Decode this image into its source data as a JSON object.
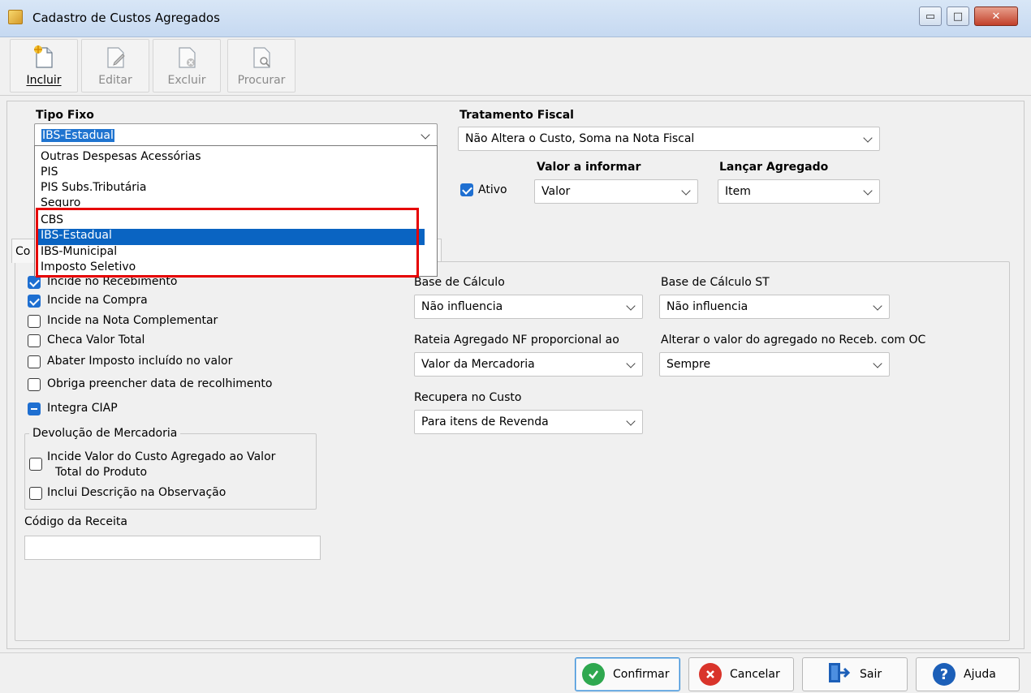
{
  "window": {
    "title": "Cadastro de Custos Agregados",
    "minimize_glyph": "▭",
    "maximize_glyph": "□",
    "close_glyph": "✕"
  },
  "toolbar": {
    "buttons": [
      {
        "label": "Incluir",
        "icon": "new-document-icon",
        "enabled": true
      },
      {
        "label": "Editar",
        "icon": "edit-document-icon",
        "enabled": false
      },
      {
        "label": "Excluir",
        "icon": "delete-document-icon",
        "enabled": false
      },
      {
        "label": "Procurar",
        "icon": "search-document-icon",
        "enabled": false
      }
    ]
  },
  "form": {
    "tipo_fixo": {
      "label": "Tipo Fixo",
      "value": "IBS-Estadual"
    },
    "tratamento_fiscal": {
      "label": "Tratamento Fiscal",
      "value": "Não Altera o Custo, Soma na Nota Fiscal"
    },
    "ativo": {
      "label": "Ativo",
      "checked": true
    },
    "valor_a_informar": {
      "label": "Valor a informar",
      "value": "Valor"
    },
    "lancar_agregado": {
      "label": "Lançar Agregado",
      "value": "Item"
    },
    "tab_stub": "Co",
    "dropdown_options": [
      "Outras Despesas Acessórias",
      "PIS",
      "PIS Subs.Tributária",
      "Seguro",
      "CBS",
      "IBS-Estadual",
      "IBS-Municipal",
      "Imposto Seletivo"
    ],
    "dropdown_selected": "IBS-Estadual",
    "checkboxes": [
      {
        "label": "Incide no Recebimento",
        "state": "checked"
      },
      {
        "label": "Incide na Compra",
        "state": "checked"
      },
      {
        "label": "Incide na Nota Complementar",
        "state": "unchecked"
      },
      {
        "label": "Checa Valor Total",
        "state": "unchecked"
      },
      {
        "label": "Abater Imposto incluído no valor",
        "state": "unchecked"
      },
      {
        "label": "Obriga preencher data de recolhimento",
        "state": "unchecked"
      },
      {
        "label": "Integra CIAP",
        "state": "indeterminate"
      }
    ],
    "devolucao": {
      "title": "Devolução de Mercadoria",
      "incide_line1": "Incide Valor do Custo Agregado ao Valor",
      "incide_line2": "Total do Produto",
      "inclui": "Inclui Descrição na Observação"
    },
    "codigo_receita": {
      "label": "Código da Receita",
      "value": ""
    },
    "base_calculo": {
      "label": "Base de Cálculo",
      "value": "Não influencia"
    },
    "base_calculo_st": {
      "label": "Base de Cálculo ST",
      "value": "Não influencia"
    },
    "rateia": {
      "label": "Rateia Agregado NF proporcional ao",
      "value": "Valor da Mercadoria"
    },
    "alterar_valor": {
      "label": "Alterar o valor do agregado no Receb. com OC",
      "value": "Sempre"
    },
    "recupera_custo": {
      "label": "Recupera no Custo",
      "value": "Para itens de Revenda"
    }
  },
  "buttons": {
    "confirmar": "Confirmar",
    "cancelar": "Cancelar",
    "sair": "Sair",
    "ajuda": "Ajuda"
  },
  "colors": {
    "accent": "#1e6fd1",
    "highlight": "#e60000",
    "confirm_green": "#2fa84f",
    "cancel_red": "#d9342b",
    "help_blue": "#1c5fb8"
  }
}
